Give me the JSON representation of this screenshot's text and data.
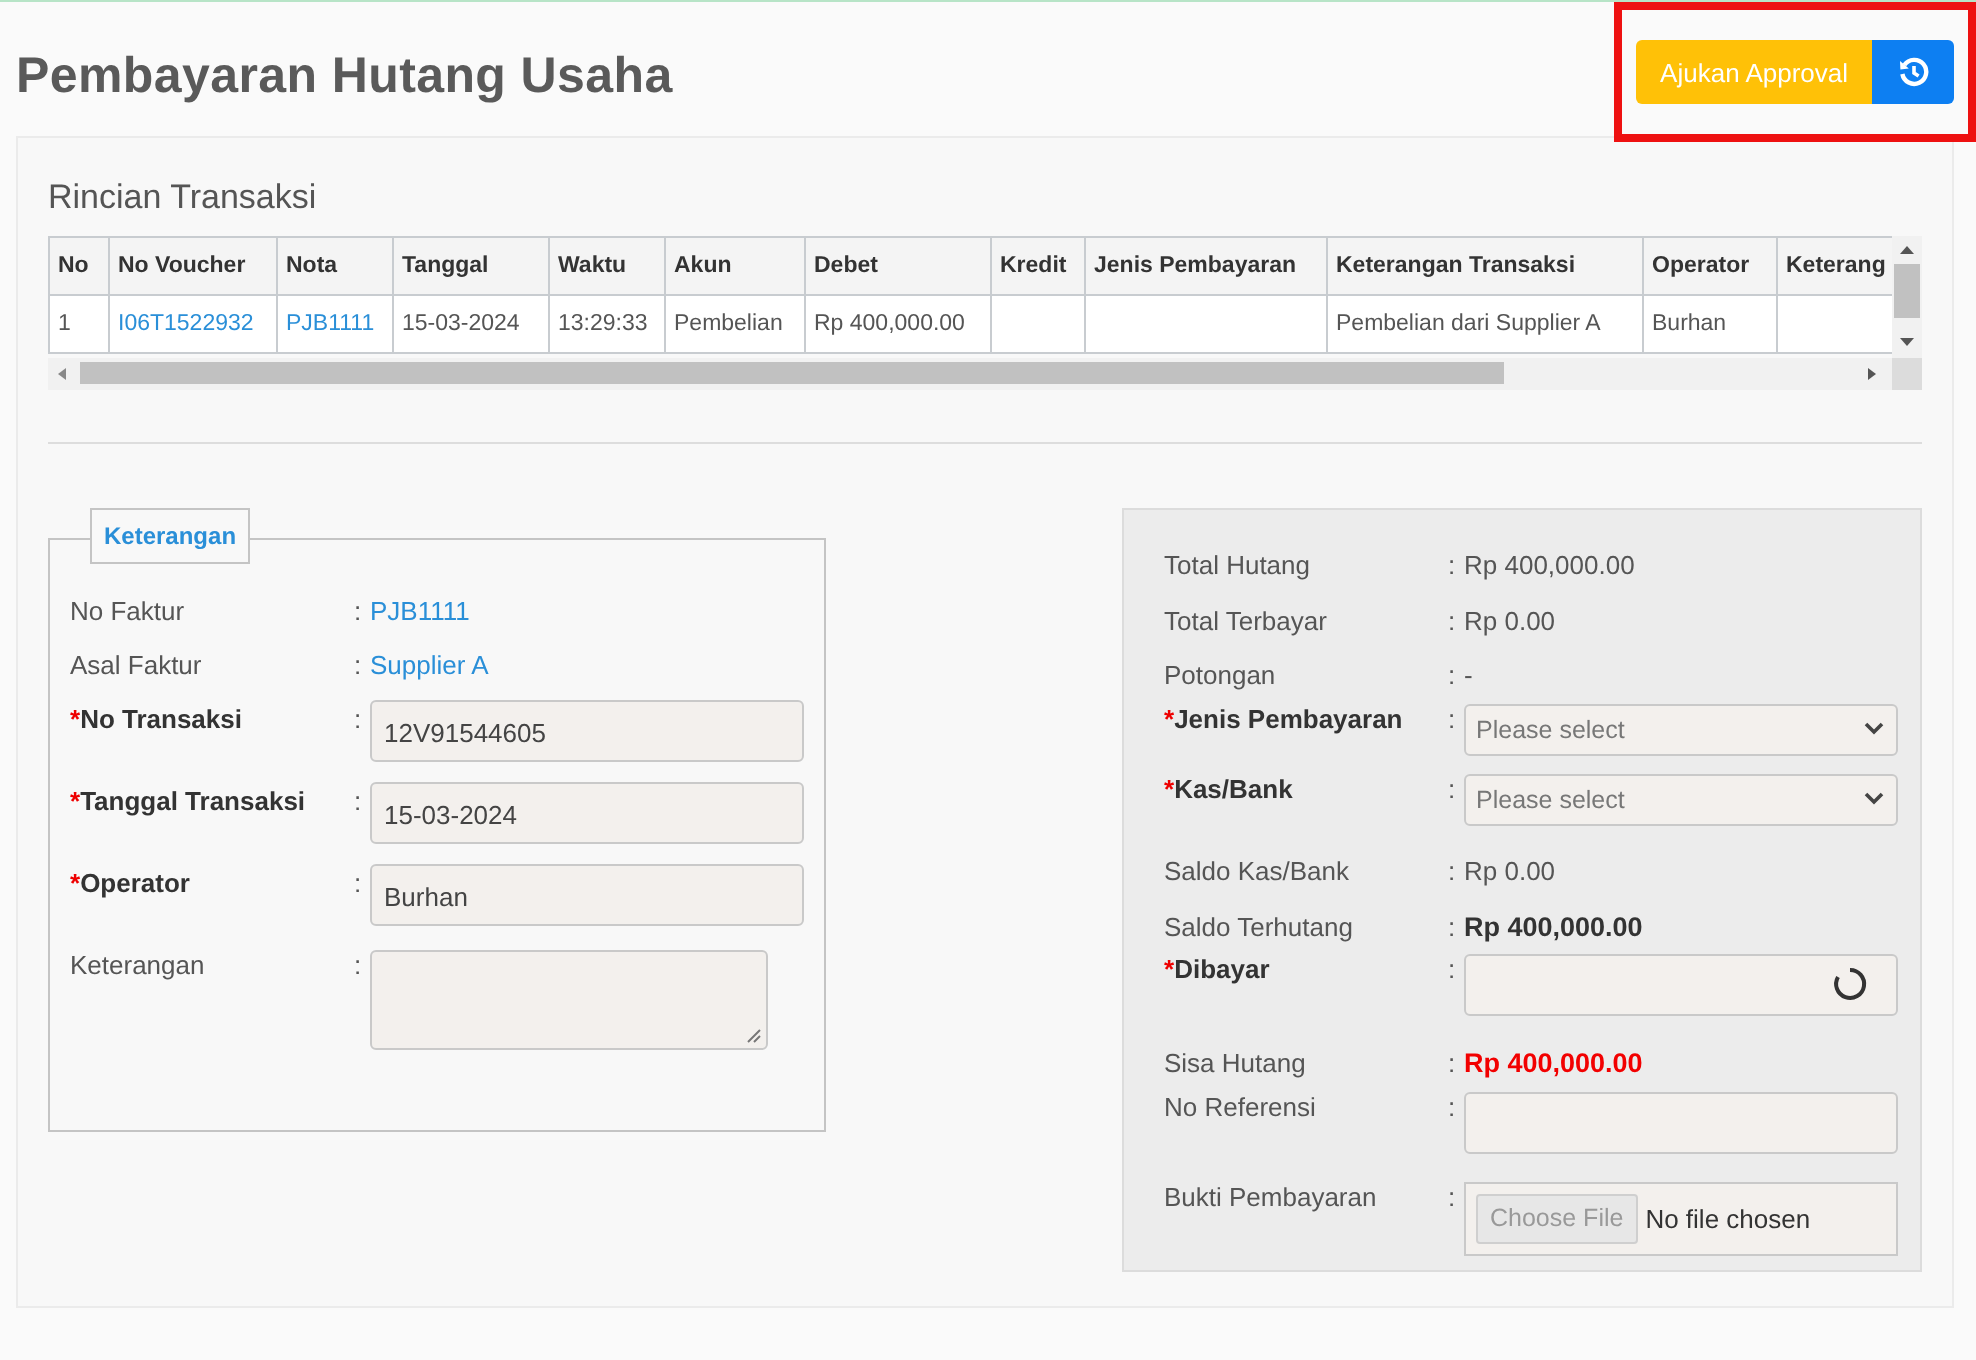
{
  "page": {
    "title": "Pembayaran Hutang Usaha"
  },
  "actions": {
    "submit": "Ajukan Approval",
    "highlighted": true
  },
  "transactions": {
    "title": "Rincian Transaksi",
    "columns": [
      {
        "label": "No",
        "kind": "text"
      },
      {
        "label": "No Voucher",
        "kind": "link"
      },
      {
        "label": "Nota",
        "kind": "link"
      },
      {
        "label": "Tanggal",
        "kind": "text"
      },
      {
        "label": "Waktu",
        "kind": "text"
      },
      {
        "label": "Akun",
        "kind": "text"
      },
      {
        "label": "Debet",
        "kind": "text"
      },
      {
        "label": "Kredit",
        "kind": "text"
      },
      {
        "label": "Jenis Pembayaran",
        "kind": "text"
      },
      {
        "label": "Keterangan Transaksi",
        "kind": "text"
      },
      {
        "label": "Operator",
        "kind": "text"
      },
      {
        "label": "Keterang",
        "kind": "text"
      }
    ],
    "rows": [
      {
        "cells": [
          "1",
          "I06T1522932",
          "PJB1111",
          "15-03-2024",
          "13:29:33",
          "Pembelian",
          "Rp 400,000.00",
          null,
          null,
          "Pembelian dari Supplier A",
          "Burhan",
          null
        ]
      }
    ]
  },
  "details": {
    "legend": "Keterangan",
    "fields": [
      {
        "kind": "link",
        "label": "No Faktur",
        "colon": ":",
        "value": "PJB1111"
      },
      {
        "kind": "link",
        "label": "Asal Faktur",
        "colon": ":",
        "value": "Supplier A"
      },
      {
        "kind": "input",
        "label": "No Transaksi",
        "mark": "*",
        "colon": ":",
        "value": "12V91544605"
      },
      {
        "kind": "input",
        "label": "Tanggal Transaksi",
        "mark": "*",
        "colon": ":",
        "value": "15-03-2024"
      },
      {
        "kind": "input",
        "label": "Operator",
        "mark": "*",
        "colon": ":",
        "value": "Burhan"
      },
      {
        "kind": "textarea",
        "label": "Keterangan",
        "colon": ":"
      }
    ]
  },
  "payment": {
    "fields": [
      {
        "kind": "value",
        "label": "Total Hutang",
        "colon": ":",
        "value": "Rp 400,000.00"
      },
      {
        "kind": "value",
        "label": "Total Terbayar",
        "colon": ":",
        "value": "Rp 0.00"
      },
      {
        "kind": "value",
        "label": "Potongan",
        "colon": ":",
        "value": "-"
      },
      {
        "kind": "select",
        "label": "Jenis Pembayaran",
        "mark": "*",
        "colon": ":",
        "placeholder": "Please select"
      },
      {
        "kind": "select",
        "label": "Kas/Bank",
        "mark": "*",
        "colon": ":",
        "placeholder": "Please select"
      },
      {
        "kind": "value",
        "label": "Saldo Kas/Bank",
        "colon": ":",
        "value": "Rp 0.00"
      },
      {
        "kind": "value",
        "label": "Saldo Terhutang",
        "colon": ":",
        "value": "Rp 400,000.00",
        "strong": true
      },
      {
        "kind": "input",
        "label": "Dibayar",
        "mark": "*",
        "colon": ":",
        "loading": true
      },
      {
        "kind": "value",
        "label": "Sisa Hutang",
        "colon": ":",
        "value": "Rp 400,000.00",
        "strong": true,
        "alert": true
      },
      {
        "kind": "input",
        "label": "No Referensi",
        "colon": ":"
      },
      {
        "kind": "file",
        "label": "Bukti Pembayaran",
        "colon": ":",
        "button": "Choose File",
        "status": "No file chosen"
      }
    ]
  }
}
